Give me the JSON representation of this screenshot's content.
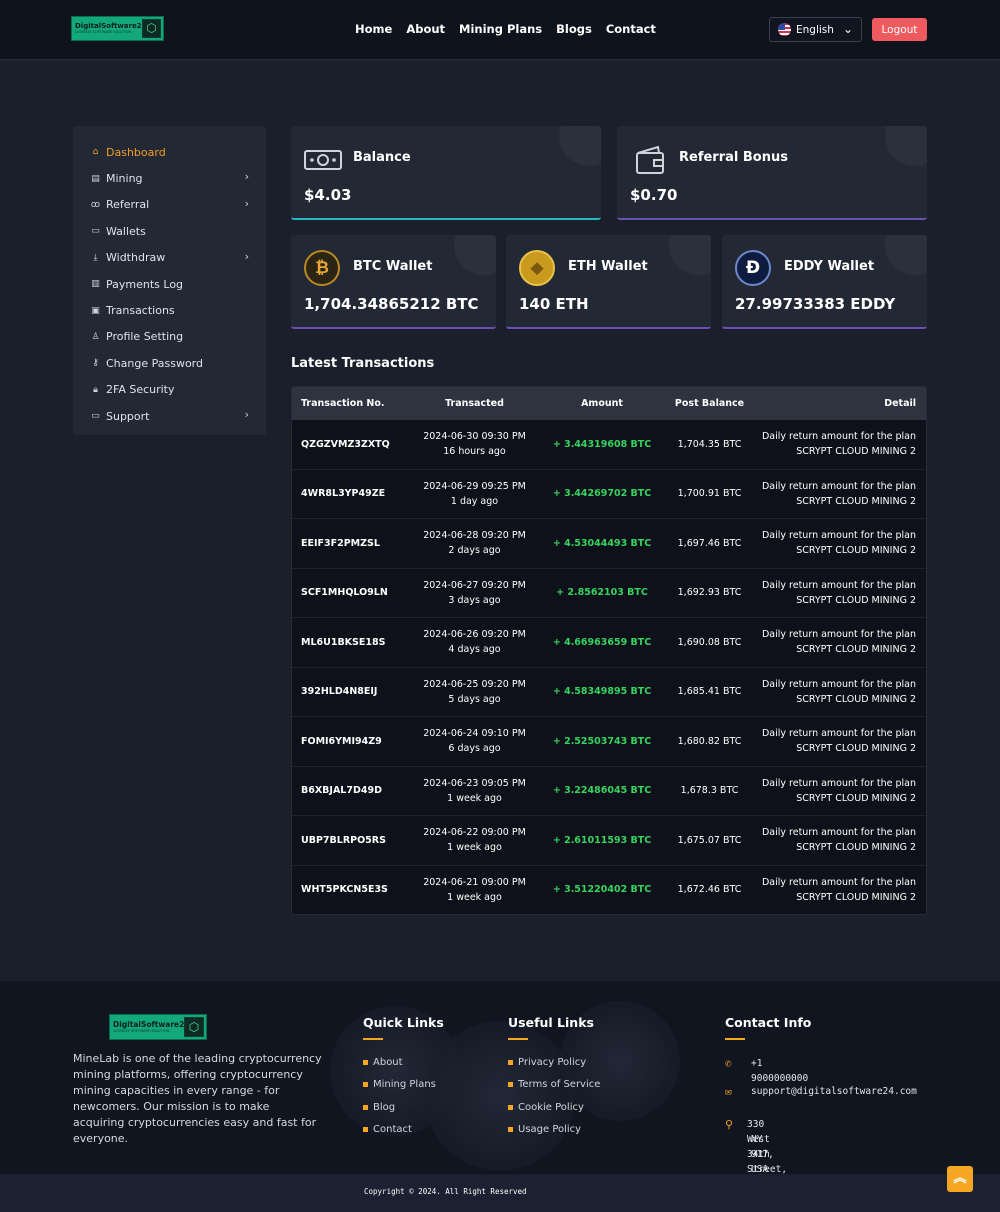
{
  "header": {
    "logo_text": "DigitalSoftware24",
    "logo_sub": "ULTIMATE SOFTWARE SOLUTION",
    "nav": [
      "Home",
      "About",
      "Mining Plans",
      "Blogs",
      "Contact"
    ],
    "language": "English",
    "logout_label": "Logout"
  },
  "sidebar": {
    "items": [
      {
        "label": "Dashboard",
        "icon": "home-icon",
        "active": true,
        "has_submenu": false
      },
      {
        "label": "Mining",
        "icon": "mining-icon",
        "active": false,
        "has_submenu": true
      },
      {
        "label": "Referral",
        "icon": "users-icon",
        "active": false,
        "has_submenu": true
      },
      {
        "label": "Wallets",
        "icon": "wallet-icon",
        "active": false,
        "has_submenu": false
      },
      {
        "label": "Widthdraw",
        "icon": "download-icon",
        "active": false,
        "has_submenu": true
      },
      {
        "label": "Payments Log",
        "icon": "document-icon",
        "active": false,
        "has_submenu": false
      },
      {
        "label": "Transactions",
        "icon": "money-icon",
        "active": false,
        "has_submenu": false
      },
      {
        "label": "Profile Setting",
        "icon": "user-icon",
        "active": false,
        "has_submenu": false
      },
      {
        "label": "Change Password",
        "icon": "key-icon",
        "active": false,
        "has_submenu": false
      },
      {
        "label": "2FA Security",
        "icon": "lock-icon",
        "active": false,
        "has_submenu": false
      },
      {
        "label": "Support",
        "icon": "ticket-icon",
        "active": false,
        "has_submenu": true
      }
    ]
  },
  "cards": {
    "balance": {
      "title": "Balance",
      "value": "$4.03",
      "icon": "money-bill-icon"
    },
    "referral": {
      "title": "Referral Bonus",
      "value": "$0.70",
      "icon": "wallet-icon"
    },
    "btc": {
      "title": "BTC Wallet",
      "value": "1,704.34865212 BTC",
      "icon": "bitcoin-icon"
    },
    "eth": {
      "title": "ETH Wallet",
      "value": "140 ETH",
      "icon": "ethereum-icon"
    },
    "eddy": {
      "title": "EDDY Wallet",
      "value": "27.99733383 EDDY",
      "icon": "eddy-coin-icon"
    }
  },
  "transactions": {
    "title": "Latest Transactions",
    "headers": [
      "Transaction No.",
      "Transacted",
      "Amount",
      "Post Balance",
      "Detail"
    ],
    "rows": [
      {
        "id": "QZGZVMZ3ZXTQ",
        "date": "2024-06-30 09:30 PM",
        "ago": "16 hours ago",
        "amount": "+ 3.44319608 BTC",
        "balance": "1,704.35 BTC",
        "detail1": "Daily return amount for the plan",
        "detail2": "SCRYPT CLOUD MINING 2"
      },
      {
        "id": "4WR8L3YP49ZE",
        "date": "2024-06-29 09:25 PM",
        "ago": "1 day ago",
        "amount": "+ 3.44269702 BTC",
        "balance": "1,700.91 BTC",
        "detail1": "Daily return amount for the plan",
        "detail2": "SCRYPT CLOUD MINING 2"
      },
      {
        "id": "EEIF3F2PMZSL",
        "date": "2024-06-28 09:20 PM",
        "ago": "2 days ago",
        "amount": "+ 4.53044493 BTC",
        "balance": "1,697.46 BTC",
        "detail1": "Daily return amount for the plan",
        "detail2": "SCRYPT CLOUD MINING 2"
      },
      {
        "id": "SCF1MHQLO9LN",
        "date": "2024-06-27 09:20 PM",
        "ago": "3 days ago",
        "amount": "+ 2.8562103 BTC",
        "balance": "1,692.93 BTC",
        "detail1": "Daily return amount for the plan",
        "detail2": "SCRYPT CLOUD MINING 2"
      },
      {
        "id": "ML6U1BKSE18S",
        "date": "2024-06-26 09:20 PM",
        "ago": "4 days ago",
        "amount": "+ 4.66963659 BTC",
        "balance": "1,690.08 BTC",
        "detail1": "Daily return amount for the plan",
        "detail2": "SCRYPT CLOUD MINING 2"
      },
      {
        "id": "392HLD4N8EIJ",
        "date": "2024-06-25 09:20 PM",
        "ago": "5 days ago",
        "amount": "+ 4.58349895 BTC",
        "balance": "1,685.41 BTC",
        "detail1": "Daily return amount for the plan",
        "detail2": "SCRYPT CLOUD MINING 2"
      },
      {
        "id": "FOMI6YMI94Z9",
        "date": "2024-06-24 09:10 PM",
        "ago": "6 days ago",
        "amount": "+ 2.52503743 BTC",
        "balance": "1,680.82 BTC",
        "detail1": "Daily return amount for the plan",
        "detail2": "SCRYPT CLOUD MINING 2"
      },
      {
        "id": "B6XBJAL7D49D",
        "date": "2024-06-23 09:05 PM",
        "ago": "1 week ago",
        "amount": "+ 3.22486045 BTC",
        "balance": "1,678.3 BTC",
        "detail1": "Daily return amount for the plan",
        "detail2": "SCRYPT CLOUD MINING 2"
      },
      {
        "id": "UBP7BLRPO5RS",
        "date": "2024-06-22 09:00 PM",
        "ago": "1 week ago",
        "amount": "+ 2.61011593 BTC",
        "balance": "1,675.07 BTC",
        "detail1": "Daily return amount for the plan",
        "detail2": "SCRYPT CLOUD MINING 2"
      },
      {
        "id": "WHT5PKCN5E3S",
        "date": "2024-06-21 09:00 PM",
        "ago": "1 week ago",
        "amount": "+ 3.51220402 BTC",
        "balance": "1,672.46 BTC",
        "detail1": "Daily return amount for the plan",
        "detail2": "SCRYPT CLOUD MINING 2"
      }
    ]
  },
  "footer": {
    "logo_text": "DigitalSoftware24",
    "logo_sub": "ULTIMATE SOFTWARE SOLUTION",
    "about": "MineLab is one of the leading cryptocurrency mining platforms, offering cryptocurrency mining capacities in every range - for newcomers. Our mission is to make acquiring cryptocurrencies easy and fast for everyone.",
    "quick_links_title": "Quick Links",
    "quick_links": [
      "About",
      "Mining Plans",
      "Blog",
      "Contact"
    ],
    "useful_links_title": "Useful Links",
    "useful_links": [
      "Privacy Policy",
      "Terms of Service",
      "Cookie Policy",
      "Usage Policy"
    ],
    "contact_title": "Contact Info",
    "phone": "+1 9000000000",
    "email": "support@digitalsoftware24.com",
    "address_line1": "330 West 34th Street, New York,",
    "address_line2": "NY 917, USA",
    "copyright": "Copyright © 2024. All Right Reserved"
  },
  "colors": {
    "accent": "#f39c23",
    "positive": "#36d35f",
    "logout": "#ee5a5f",
    "logo_green": "#13a87a"
  }
}
